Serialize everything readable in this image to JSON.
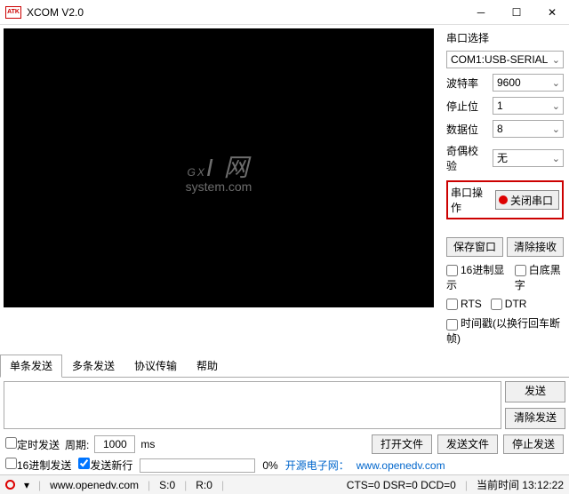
{
  "window": {
    "title": "XCOM V2.0",
    "icon_text": "ATK"
  },
  "port_section": {
    "label": "串口选择",
    "port_select": "COM1:USB-SERIAL",
    "baud_label": "波特率",
    "baud_value": "9600",
    "stop_label": "停止位",
    "stop_value": "1",
    "data_label": "数据位",
    "data_value": "8",
    "parity_label": "奇偶校验",
    "parity_value": "无",
    "op_label": "串口操作",
    "op_button": "关闭串口"
  },
  "actions": {
    "save_window": "保存窗口",
    "clear_receive": "清除接收",
    "hex_display": "16进制显示",
    "white_bg": "白底黑字",
    "rts": "RTS",
    "dtr": "DTR",
    "timestamp": "时间戳(以换行回车断帧)"
  },
  "tabs": {
    "t1": "单条发送",
    "t2": "多条发送",
    "t3": "协议传输",
    "t4": "帮助"
  },
  "send_buttons": {
    "send": "发送",
    "clear_send": "清除发送"
  },
  "timer_row": {
    "timed_send": "定时发送",
    "period_label": "周期:",
    "period_value": "1000",
    "period_unit": "ms",
    "open_file": "打开文件",
    "send_file": "发送文件",
    "stop_send": "停止发送"
  },
  "options_row": {
    "hex_send": "16进制发送",
    "send_newline": "发送新行",
    "progress_pct": "0%",
    "site_label": "开源电子网：",
    "site_url": "www.openedv.com"
  },
  "status_bar": {
    "url": "www.openedv.com",
    "s": "S:0",
    "r": "R:0",
    "signals": "CTS=0 DSR=0 DCD=0",
    "time_label": "当前时间 13:12:22"
  },
  "watermark": {
    "brand": "GX",
    "suffix": "I 网",
    "sub": "system.com"
  }
}
